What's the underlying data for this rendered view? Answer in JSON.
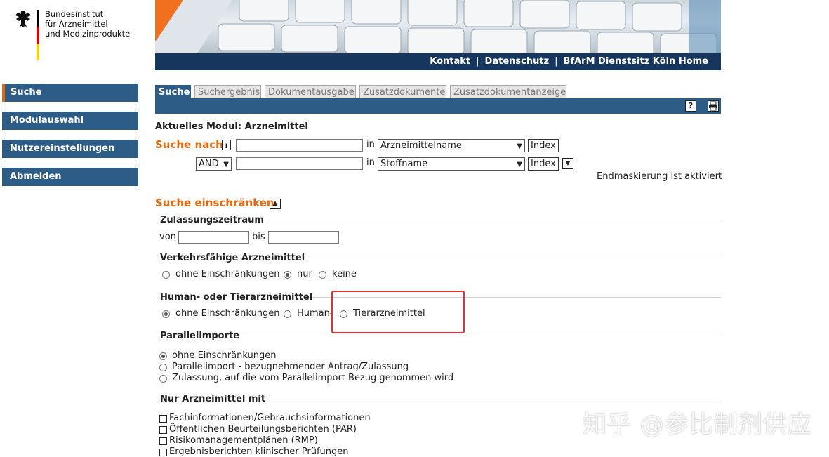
{
  "logo": {
    "line1": "Bundesinstitut",
    "line2": "für Arzneimittel",
    "line3": "und Medizinprodukte"
  },
  "sidebar": {
    "items": [
      {
        "label": "Suche"
      },
      {
        "label": "Modulauswahl"
      },
      {
        "label": "Nutzereinstellungen"
      },
      {
        "label": "Abmelden"
      }
    ]
  },
  "toplinks": {
    "contact": "Kontakt",
    "privacy": "Datenschutz",
    "home": "BfArM Dienstsitz Köln Home"
  },
  "tabs": [
    {
      "label": "Suche"
    },
    {
      "label": "Suchergebnis"
    },
    {
      "label": "Dokumentausgabe"
    },
    {
      "label": "Zusatzdokumente"
    },
    {
      "label": "Zusatzdokumentanzeige"
    }
  ],
  "icons": {
    "help": "help-icon",
    "print": "print-icon",
    "info": "info-icon",
    "collapse": "collapse-icon"
  },
  "module": {
    "label": "Aktuelles Modul: Arzneimittel"
  },
  "search": {
    "title": "Suche nach",
    "in_label": "in",
    "row1_value": "",
    "row1_field": "Arzneimittelname",
    "row2_operator": "AND",
    "row2_value": "",
    "row2_field": "Stoffname",
    "index_label": "Index",
    "masking_note": "Endmaskierung ist aktiviert"
  },
  "restrict": {
    "title": "Suche einschränken",
    "approval": {
      "title": "Zulassungszeitraum",
      "from_label": "von",
      "to_label": "bis",
      "from_value": "",
      "to_value": ""
    },
    "marketable": {
      "title": "Verkehrsfähige Arzneimittel",
      "options": [
        "ohne Einschränkungen",
        "nur",
        "keine"
      ],
      "selected": 1
    },
    "human_vet": {
      "title": "Human- oder Tierarzneimittel",
      "options": [
        "ohne Einschränkungen",
        "Human-",
        "Tierarzneimittel"
      ],
      "selected": 0
    },
    "parallel": {
      "title": "Parallelimporte",
      "options": [
        "ohne Einschränkungen",
        "Parallelimport - bezugnehmender Antrag/Zulassung",
        "Zulassung, auf die vom Parallelimport Bezug genommen wird"
      ],
      "selected": 0
    },
    "only_with": {
      "title": "Nur Arzneimittel mit",
      "options": [
        "Fachinformationen/Gebrauchsinformationen",
        "Öffentlichen Beurteilungsberichten (PAR)",
        "Risikomanagementplänen (RMP)",
        "Ergebnisberichten klinischer Prüfungen"
      ]
    }
  },
  "watermark": "知乎 @参比制剂供应",
  "colors": {
    "nav_bg": "#2d5d87",
    "topbar_bg": "#17365d",
    "accent": "#e46a12",
    "highlight": "#e03030"
  }
}
